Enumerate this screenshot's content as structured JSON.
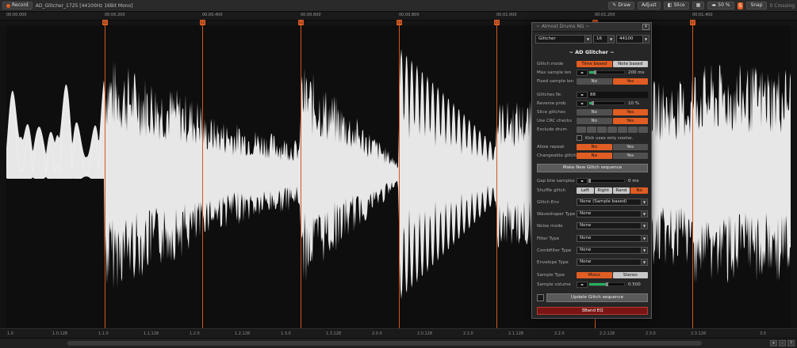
{
  "topbar": {
    "record_label": "Record",
    "file_title": "AD_Glitcher_1725 [44100Hz 16Bit Mono]",
    "draw_label": "Draw",
    "adjust_label": "Adjust",
    "slice_label": "Slice",
    "zoom": "50",
    "zoom_unit": "%",
    "badge": "S",
    "snap_label": "Snap",
    "crossing_label": "0 Crossing"
  },
  "ruler": {
    "ticks": [
      "00:00.000",
      "00:00.200",
      "00:00.400",
      "00:00.600",
      "00:00.800",
      "00:01.000",
      "00:01.200",
      "00:01.400"
    ]
  },
  "markers": [
    "01",
    "02",
    "03",
    "04",
    "05",
    "06",
    "07"
  ],
  "bottom_ruler": {
    "ticks": [
      "1.0",
      "1.0.128",
      "1.1.0",
      "1.1.128",
      "1.2.0",
      "1.2.128",
      "1.3.0",
      "1.3.128",
      "2.0.0",
      "2.0.128",
      "2.1.0",
      "2.1.128",
      "2.2.0",
      "2.2.128",
      "2.3.0",
      "2.3.128",
      "3.0"
    ]
  },
  "status_icons": [
    "+",
    "-",
    "?"
  ],
  "panel": {
    "title": "~ Almost Drums NG ~",
    "close_label": "×",
    "preset": "Glitcher",
    "bits": "16",
    "rate": "44100",
    "heading": "~ AD Glitcher ~",
    "glitch_mode": {
      "label": "Glitch mode",
      "options": [
        "Time based",
        "Note based"
      ]
    },
    "max_sample_len": {
      "label": "Max sample len",
      "value": "200",
      "unit": "ms",
      "fraction": 0.15
    },
    "fixed_sample_len": {
      "label": "Fixed sample len",
      "options": [
        "No",
        "Yes"
      ]
    },
    "glitches_nr": {
      "label": "Glitches Nr.",
      "value": "88"
    },
    "reverse_prob": {
      "label": "Reverse prob.",
      "value": "10",
      "unit": "%",
      "fraction": 0.1
    },
    "slice_glitches": {
      "label": "Slice glitches",
      "options": [
        "No",
        "Yes"
      ]
    },
    "use_crc_checks": {
      "label": "Use CRC checks",
      "options": [
        "No",
        "Yes"
      ]
    },
    "exclude_drum": {
      "label": "Exclude drum"
    },
    "kick_note": "Kick uses only cosine.",
    "allow_repeat": {
      "label": "Allow repeat",
      "options": [
        "No",
        "Yes"
      ]
    },
    "changeable_glitch": {
      "label": "Changeable glitch",
      "options": [
        "No",
        "Yes"
      ]
    },
    "make_new_label": "Make New Glitch sequence",
    "gap_btw_samples": {
      "label": "Gap btw samples",
      "value": "0",
      "unit": "ms",
      "fraction": 0.0
    },
    "shuffle_glitch": {
      "label": "Shuffle glitch",
      "options": [
        "Left",
        "Right",
        "Rand",
        "No"
      ]
    },
    "glitch_env": {
      "label": "Glitch Env",
      "value": "None (Sample based)"
    },
    "waveshaper_type": {
      "label": "Waveshaper Type",
      "value": "None"
    },
    "noise_mode": {
      "label": "Noise mode",
      "value": "None"
    },
    "filter_type": {
      "label": "Filter Type",
      "value": "None"
    },
    "combfilter_type": {
      "label": "Combfilter Type",
      "value": "None"
    },
    "envelope_type": {
      "label": "Envelope Type",
      "value": "None"
    },
    "sample_type": {
      "label": "Sample Type",
      "options": [
        "Mono",
        "Stereo"
      ]
    },
    "sample_volume": {
      "label": "Sample volume",
      "value": "0.500",
      "fraction": 0.5
    },
    "update_label": "Update Glitch sequence",
    "eq_label": "3Band EQ"
  },
  "colors": {
    "accent": "#e05d23",
    "slider_green": "#26b05e",
    "background": "#121212",
    "panel": "#262626"
  }
}
